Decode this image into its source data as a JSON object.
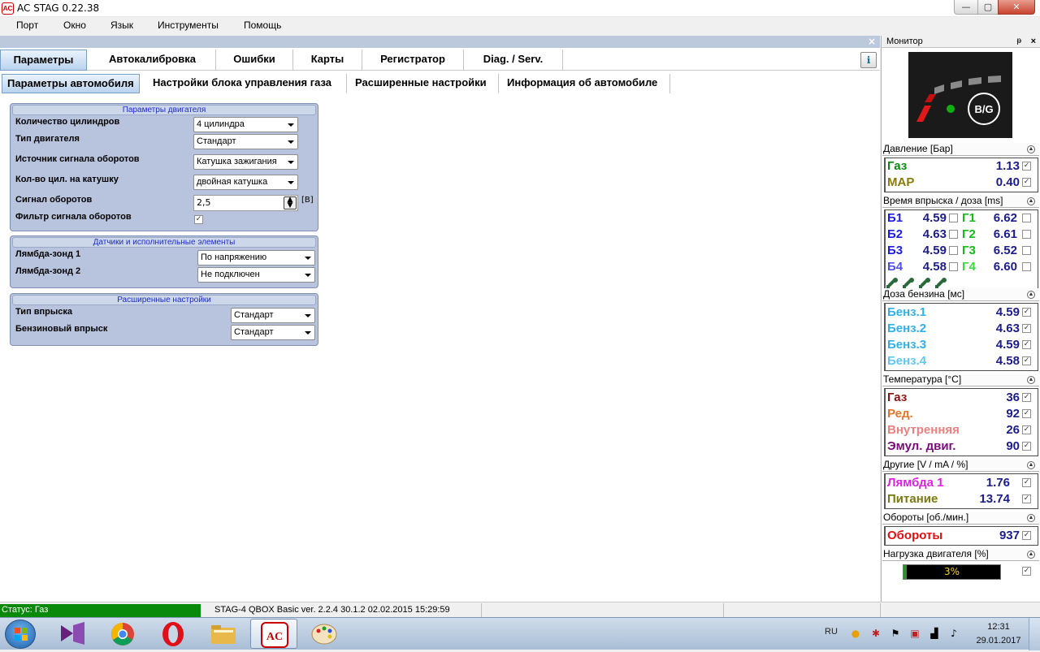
{
  "window": {
    "title": "AC STAG 0.22.38",
    "app_icon_text": "AC",
    "min": "—",
    "max": "▢",
    "close": "✕"
  },
  "menu": [
    "Порт",
    "Окно",
    "Язык",
    "Инструменты",
    "Помощь"
  ],
  "tabs_main": [
    "Параметры",
    "Автокалибровка",
    "Ошибки",
    "Карты",
    "Регистратор",
    "Diag. / Serv."
  ],
  "tabs_sub": [
    "Параметры автомобиля",
    "Настройки блока управления газа",
    "Расширенные настройки",
    "Информация об автомобиле"
  ],
  "main_close": "×",
  "help_icon": "ℹ",
  "groups": {
    "engine": {
      "title": "Параметры двигателя",
      "rows": [
        {
          "label": "Количество цилиндров",
          "value": "4 цилиндра"
        },
        {
          "label": "Тип двигателя",
          "value": "Стандарт"
        },
        {
          "label": "Источник сигнала оборотов",
          "value": "Катушка зажигания"
        },
        {
          "label": "Кол-во цил. на катушку",
          "value": "двойная катушка"
        },
        {
          "label": "Сигнал оборотов",
          "value": "2,5",
          "unit": "[В]"
        },
        {
          "label": "Фильтр сигнала оборотов",
          "checked": "✓"
        }
      ]
    },
    "sensors": {
      "title": "Датчики и исполнительные элементы",
      "rows": [
        {
          "label": "Лямбда-зонд 1",
          "value": "По напряжению"
        },
        {
          "label": "Лямбда-зонд 2",
          "value": "Не подключен"
        }
      ]
    },
    "advanced": {
      "title": "Расширенные настройки",
      "rows": [
        {
          "label": "Тип впрыска",
          "value": "Стандарт"
        },
        {
          "label": "Бензиновый впрыск",
          "value": "Стандарт"
        }
      ]
    }
  },
  "monitor": {
    "title": "Монитор",
    "pin": "ᵽ",
    "close": "×",
    "logo_text": "B/G",
    "pressure": {
      "title": "Давление [Бар]",
      "items": [
        {
          "name": "Газ",
          "value": "1.13",
          "color": "#0a8a0a"
        },
        {
          "name": "MAP",
          "value": "0.40",
          "color": "#8a7a0a"
        }
      ]
    },
    "injection": {
      "title": "Время впрыска / доза [ms]",
      "rows": [
        {
          "b": "Б1",
          "bv": "4.59",
          "g": "Г1",
          "gv": "6.62"
        },
        {
          "b": "Б2",
          "bv": "4.63",
          "g": "Г2",
          "gv": "6.61"
        },
        {
          "b": "Б3",
          "bv": "4.59",
          "g": "Г3",
          "gv": "6.52"
        },
        {
          "b": "Б4",
          "bv": "4.58",
          "g": "Г4",
          "gv": "6.60"
        }
      ]
    },
    "petrol": {
      "title": "Доза бензина [мс]",
      "items": [
        {
          "name": "Бенз.1",
          "value": "4.59"
        },
        {
          "name": "Бенз.2",
          "value": "4.63"
        },
        {
          "name": "Бенз.3",
          "value": "4.59"
        },
        {
          "name": "Бенз.4",
          "value": "4.58"
        }
      ]
    },
    "temperature": {
      "title": "Температура [°C]",
      "items": [
        {
          "name": "Газ",
          "value": "36",
          "color": "#8b1010"
        },
        {
          "name": "Ред.",
          "value": "92",
          "color": "#e8742a"
        },
        {
          "name": "Внутренняя",
          "value": "26",
          "color": "#ef7f7f"
        },
        {
          "name": "Эмул. двиг.",
          "value": "90",
          "color": "#7a0a7a"
        }
      ]
    },
    "other": {
      "title": "Другие [V / mA / %]",
      "items": [
        {
          "name": "Лямбда 1",
          "value": "1.76",
          "color": "#e020e0"
        },
        {
          "name": "Питание",
          "value": "13.74",
          "color": "#7a7a10"
        }
      ]
    },
    "rpm": {
      "title": "Обороты [об./мин.]",
      "name": "Обороты",
      "value": "937",
      "color": "#e01010"
    },
    "load": {
      "title": "Нагрузка двигателя [%]",
      "value_text": "3%",
      "fraction": 0.03
    },
    "check": "✓"
  },
  "status": {
    "gas": "Статус: Газ",
    "version": "STAG-4 QBOX Basic  ver. 2.2.4  30.1.2   02.02.2015 15:29:59"
  },
  "taskbar": {
    "lang": "RU",
    "time": "12:31",
    "date": "29.01.2017"
  }
}
